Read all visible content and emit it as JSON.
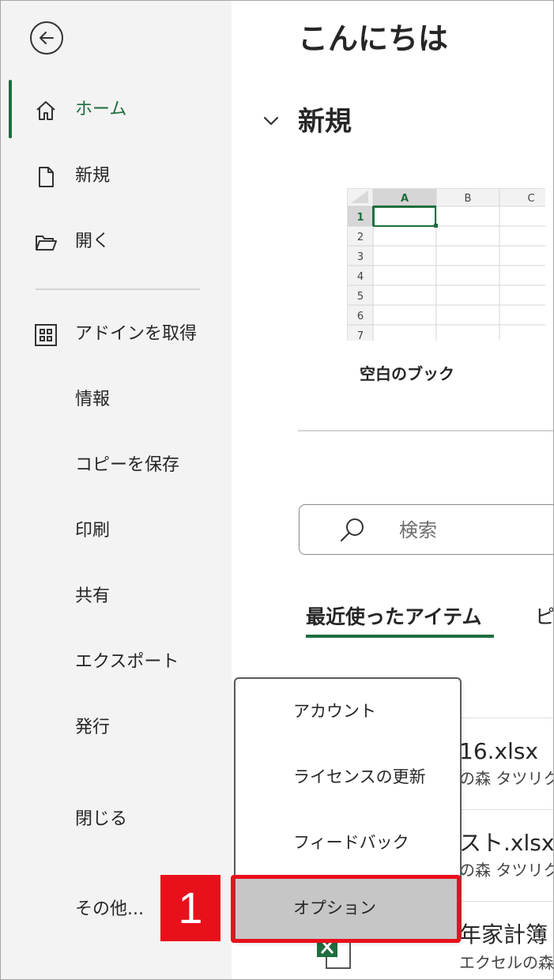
{
  "sidebar": {
    "items": [
      {
        "key": "home",
        "label": "ホーム",
        "icon": "home-icon",
        "active": true
      },
      {
        "key": "new",
        "label": "新規",
        "icon": "new-file-icon"
      },
      {
        "key": "open",
        "label": "開く",
        "icon": "folder-open-icon"
      },
      {
        "key": "addins",
        "label": "アドインを取得",
        "icon": "addins-grid-icon"
      },
      {
        "key": "info",
        "label": "情報"
      },
      {
        "key": "save-copy",
        "label": "コピーを保存"
      },
      {
        "key": "print",
        "label": "印刷"
      },
      {
        "key": "share",
        "label": "共有"
      },
      {
        "key": "export",
        "label": "エクスポート"
      },
      {
        "key": "publish",
        "label": "発行"
      },
      {
        "key": "close",
        "label": "閉じる"
      },
      {
        "key": "more",
        "label": "その他..."
      }
    ],
    "back_icon": "back-arrow-icon"
  },
  "main": {
    "greeting": "こんにちは",
    "new_section": {
      "title": "新規",
      "template_label": "空白のブック",
      "sheet_columns": [
        "A",
        "B",
        "C"
      ],
      "sheet_rows": [
        "1",
        "2",
        "3",
        "4",
        "5",
        "6",
        "7"
      ]
    },
    "search": {
      "placeholder": "検索"
    },
    "tabs": {
      "recent": "最近使ったアイテム",
      "pinned": "ピ"
    },
    "files": [
      {
        "name": "16.xlsx",
        "meta": "の森 タツリク"
      },
      {
        "name": "スト.xlsx",
        "meta": "の森 タツリク"
      },
      {
        "name": "年家計簿",
        "meta": "エクセルの森 タツリク"
      }
    ]
  },
  "popup": {
    "items": [
      {
        "label": "アカウント"
      },
      {
        "label": "ライセンスの更新"
      },
      {
        "label": "フィードバック"
      },
      {
        "label": "オプション",
        "selected": true
      }
    ]
  },
  "annotation": {
    "step": "1"
  },
  "colors": {
    "accent": "#1e6e3e",
    "highlight": "#e8101b",
    "sidebar_bg": "#f3f3f3",
    "selected_bg": "#c6c6c6"
  }
}
